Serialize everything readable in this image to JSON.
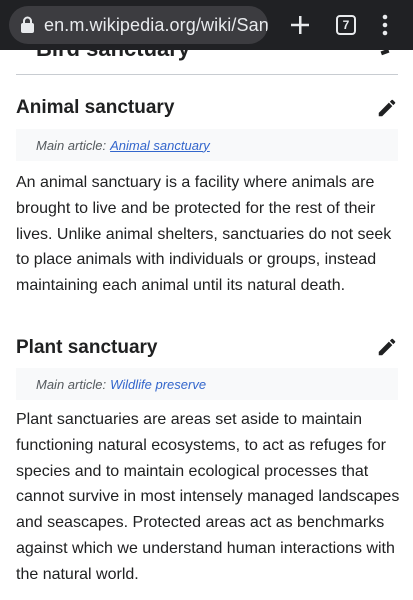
{
  "browser": {
    "url": "en.m.wikipedia.org/wiki/Sanctu",
    "tab_count": "7"
  },
  "previous_section": {
    "heading_fragment": "Bird sanctuary"
  },
  "sections": [
    {
      "heading": "Animal sanctuary",
      "hatnote_prefix": "Main article:",
      "hatnote_link": "Animal sanctuary",
      "body": "An animal sanctuary is a facility where animals are brought to live and be protected for the rest of their lives. Unlike animal shelters, sanctuaries do not seek to place animals with individuals or groups, instead maintaining each animal until its natural death."
    },
    {
      "heading": "Plant sanctuary",
      "hatnote_prefix": "Main article:",
      "hatnote_link": "Wildlife preserve",
      "body": "Plant sanctuaries are areas set aside to maintain functioning natural ecosystems, to act as refuges for species and to maintain ecological processes that cannot survive in most intensely managed landscapes and seascapes. Protected areas act as benchmarks against which we understand human interactions with the natural world."
    }
  ],
  "colors": {
    "browser_bar": "#202124",
    "url_pill": "#3c3c40",
    "link": "#3366cc",
    "hatnote_bg": "#f8f9fa"
  }
}
